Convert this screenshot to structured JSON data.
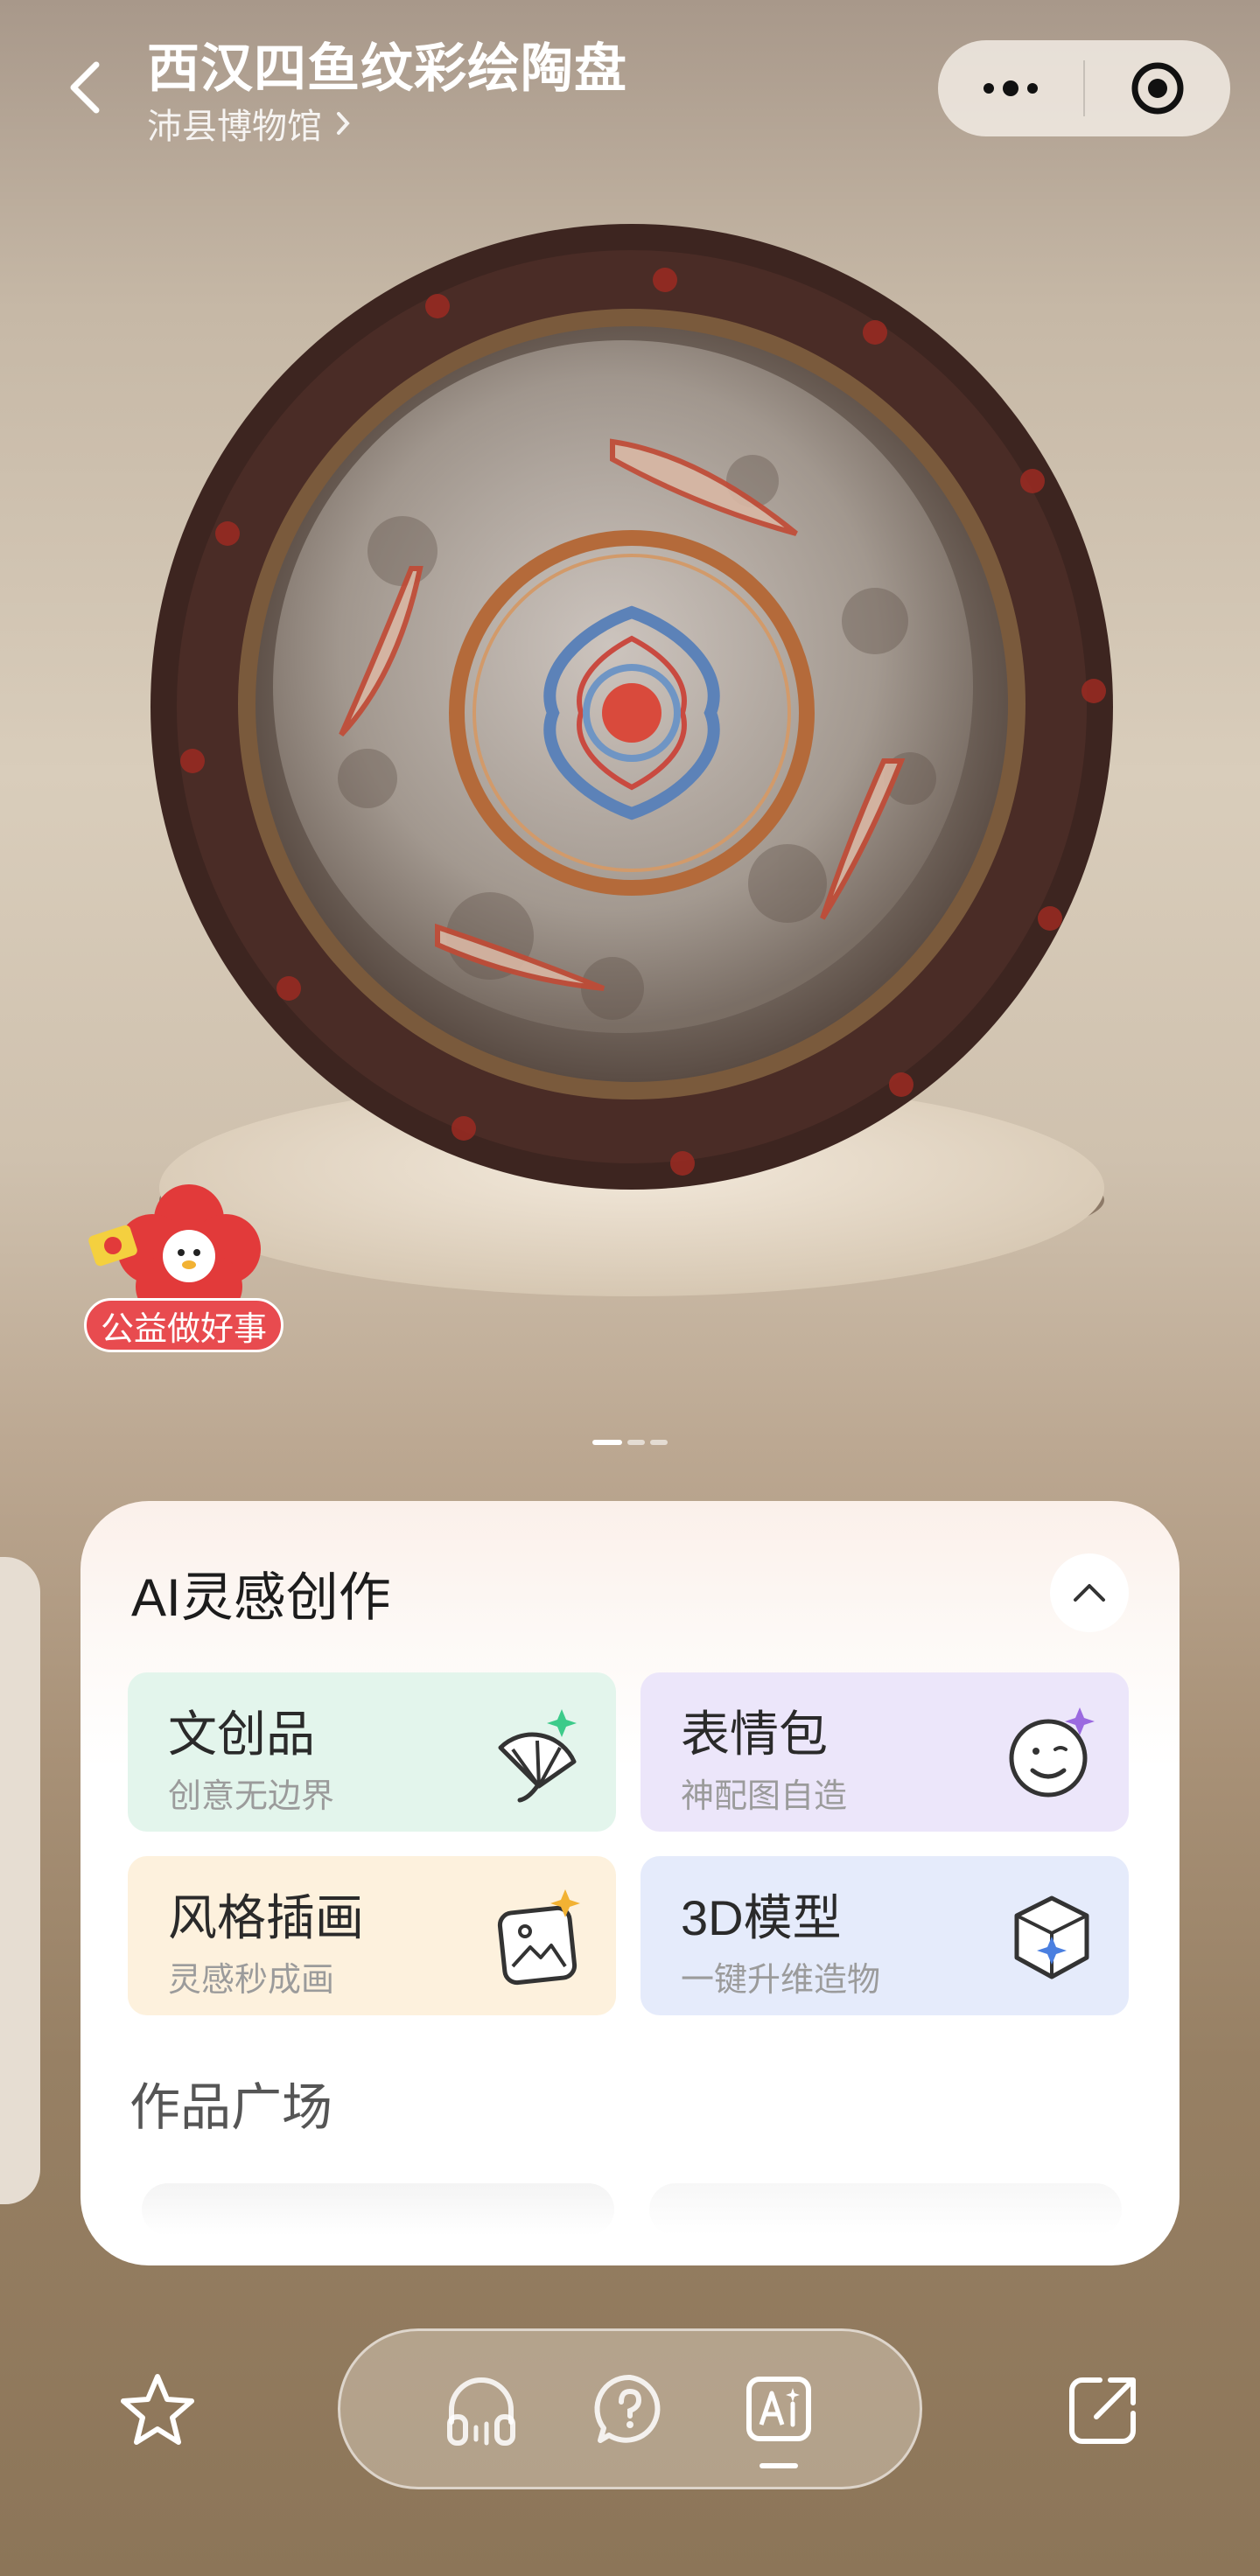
{
  "header": {
    "title": "西汉四鱼纹彩绘陶盘",
    "museum": "沛县博物馆"
  },
  "charity": {
    "badge": "公益做好事"
  },
  "carousel": {
    "pages": 3,
    "active": 1
  },
  "ai_panel": {
    "title": "AI灵感创作",
    "features": [
      {
        "name": "文创品",
        "desc": "创意无边界",
        "icon": "fan-sparkle-icon",
        "bg": "#e3f5ec"
      },
      {
        "name": "表情包",
        "desc": "神配图自造",
        "icon": "smiley-sparkle-icon",
        "bg": "#ece6fa"
      },
      {
        "name": "风格插画",
        "desc": "灵感秒成画",
        "icon": "picture-sparkle-icon",
        "bg": "#fdf1dd"
      },
      {
        "name": "3D模型",
        "desc": "一键升维造物",
        "icon": "cube-sparkle-icon",
        "bg": "#e5ebfb"
      }
    ],
    "gallery_title": "作品广场"
  },
  "bottom_bar": {
    "tabs": [
      "headphones-icon",
      "question-icon",
      "ai-icon"
    ],
    "active_tab": "ai-icon"
  },
  "colors": {
    "accent_red": "#e84b4f",
    "panel_bg": "#ffffff"
  }
}
